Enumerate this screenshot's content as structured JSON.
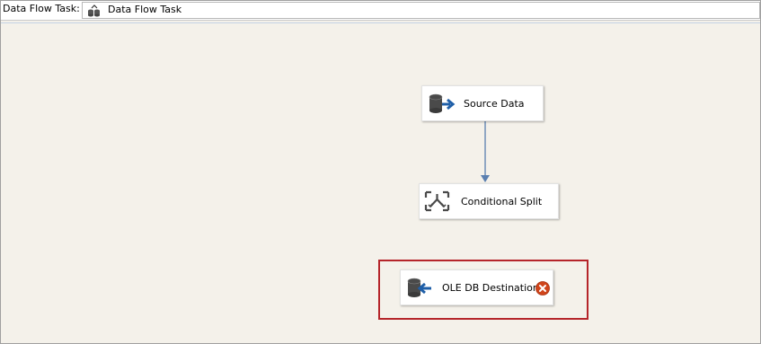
{
  "toolbar": {
    "label": "Data Flow Task:",
    "task_selector_value": "Data Flow Task",
    "task_icon": "data-flow-task-icon"
  },
  "canvas": {
    "background_color": "#f4f1ea",
    "nodes": {
      "source": {
        "label": "Source Data",
        "icon": "source-database-icon"
      },
      "split": {
        "label": "Conditional Split",
        "icon": "conditional-split-icon"
      },
      "destination": {
        "label": "OLE DB Destination",
        "icon": "destination-database-icon",
        "status": "error"
      }
    },
    "connector_color": "#5a7fb0",
    "highlight_color": "#b5252a",
    "error_color": "#d0451b"
  }
}
